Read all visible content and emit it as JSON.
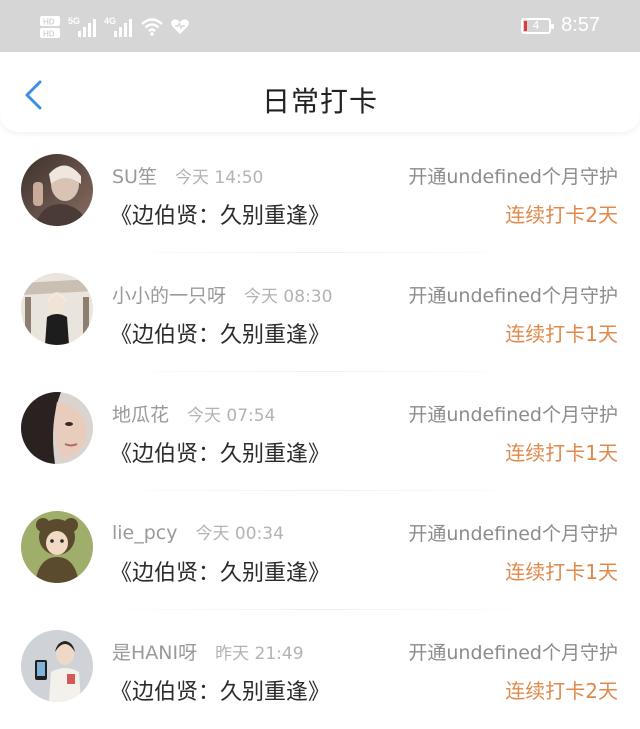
{
  "status_bar": {
    "left_tags": [
      "HD",
      "5G",
      "4G"
    ],
    "battery_level": "4",
    "time": "8:57"
  },
  "header": {
    "title": "日常打卡"
  },
  "colors": {
    "accent": "#e0894a",
    "back_arrow": "#3a8ee6",
    "status_bg": "#d6d6d6"
  },
  "checkins": [
    {
      "user": "SU笙",
      "time": "今天 14:50",
      "book": "《边伯贤：久别重逢》",
      "guard": "开通undefined个月守护",
      "streak": "连续打卡2天"
    },
    {
      "user": "小小的一只呀",
      "time": "今天 08:30",
      "book": "《边伯贤：久别重逢》",
      "guard": "开通undefined个月守护",
      "streak": "连续打卡1天"
    },
    {
      "user": "地瓜花",
      "time": "今天 07:54",
      "book": "《边伯贤：久别重逢》",
      "guard": "开通undefined个月守护",
      "streak": "连续打卡1天"
    },
    {
      "user": "lie_pcy",
      "time": "今天 00:34",
      "book": "《边伯贤：久别重逢》",
      "guard": "开通undefined个月守护",
      "streak": "连续打卡1天"
    },
    {
      "user": "是HANI呀",
      "time": "昨天 21:49",
      "book": "《边伯贤：久别重逢》",
      "guard": "开通undefined个月守护",
      "streak": "连续打卡2天"
    }
  ]
}
